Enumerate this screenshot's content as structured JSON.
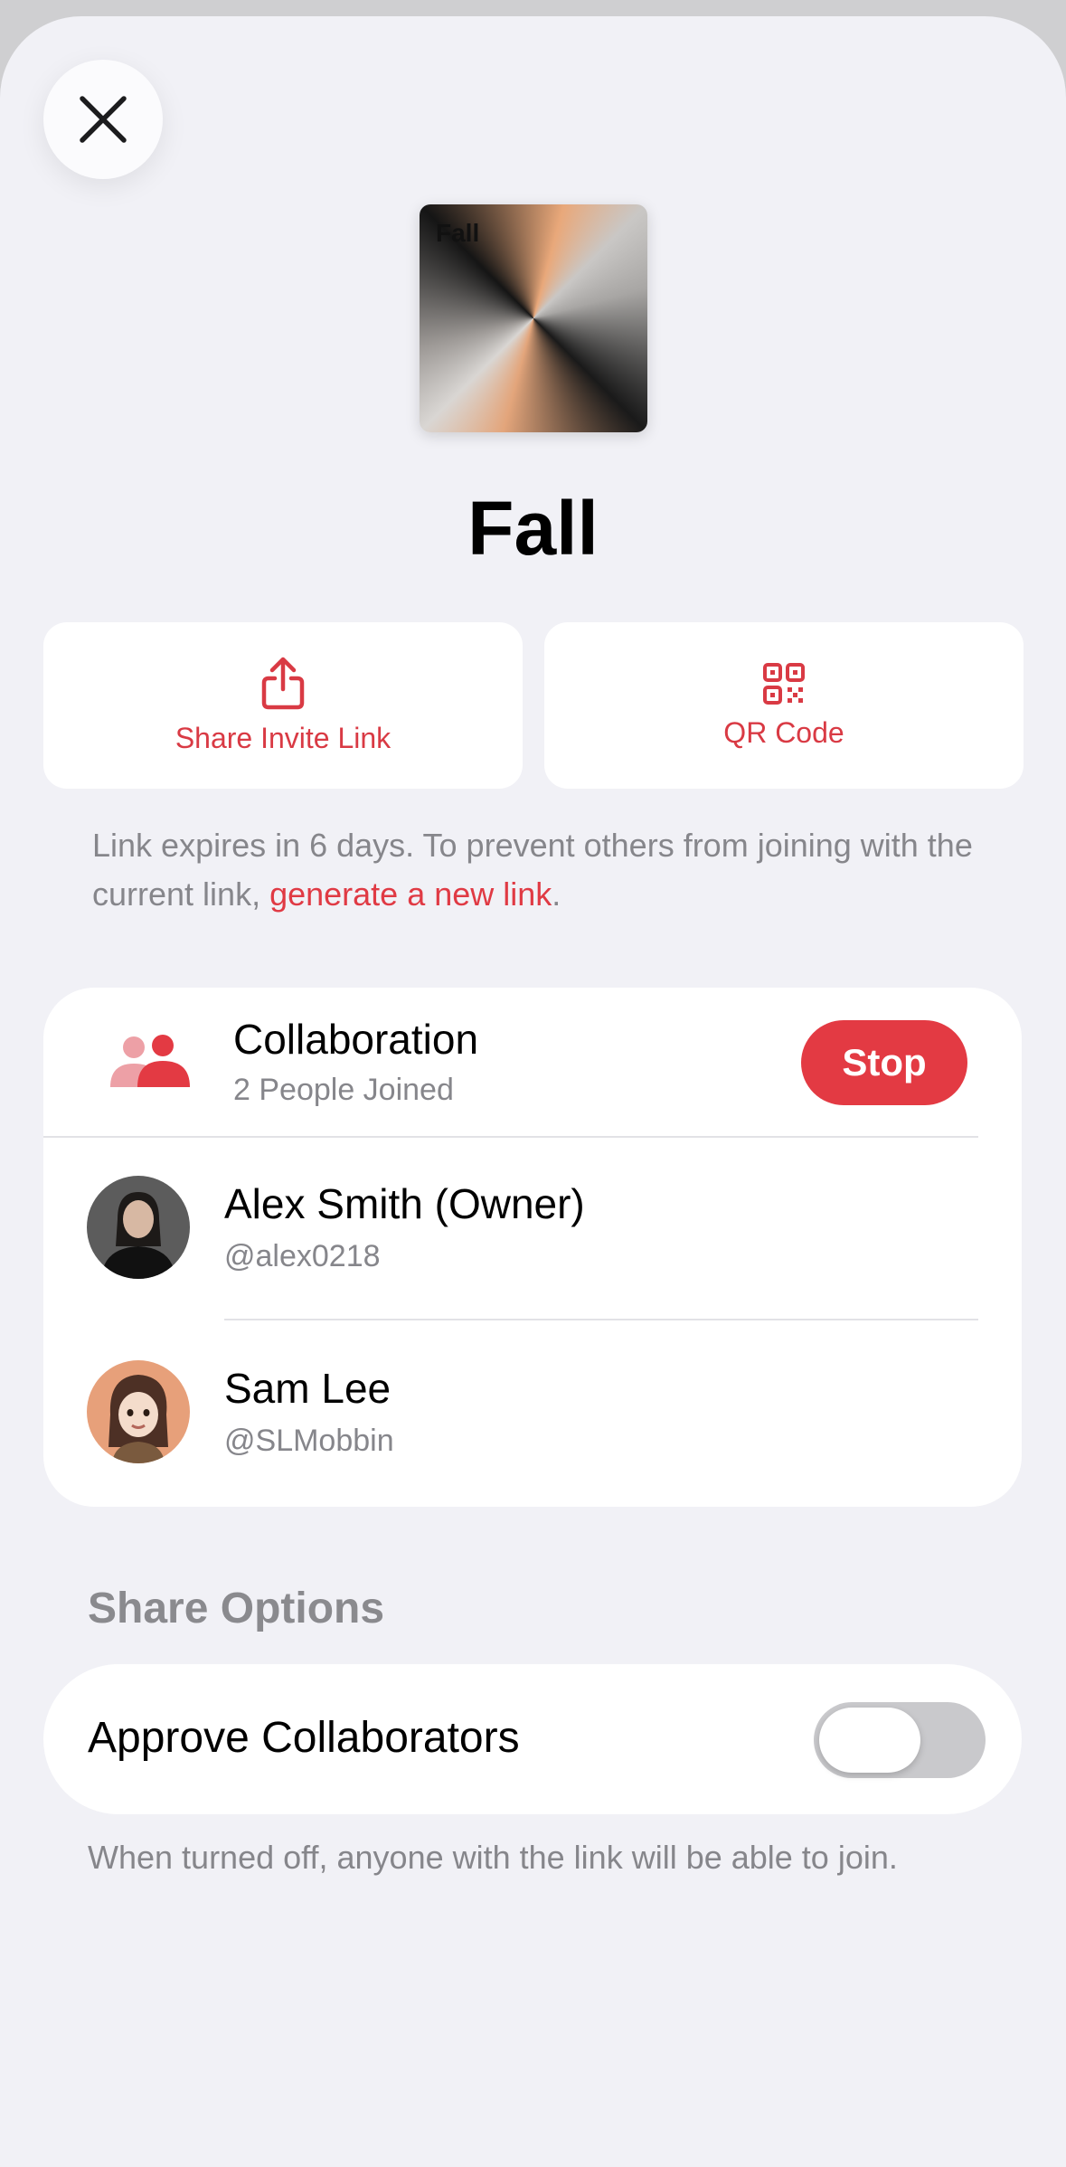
{
  "sheet": {
    "close_icon": "close-icon"
  },
  "artwork": {
    "label": "Fall"
  },
  "playlist": {
    "title": "Fall"
  },
  "actions": {
    "share_label": "Share Invite Link",
    "share_icon": "share-icon",
    "qr_label": "QR Code",
    "qr_icon": "qr-code-icon"
  },
  "link_note": {
    "text": "Link expires in 6 days. To prevent others from joining with the current link, ",
    "link_text": "generate a new link",
    "suffix": "."
  },
  "collaboration": {
    "title": "Collaboration",
    "subtitle": "2 People Joined",
    "stop_label": "Stop",
    "icon": "people-icon",
    "members": [
      {
        "name": "Alex Smith (Owner)",
        "handle": "@alex0218"
      },
      {
        "name": "Sam Lee",
        "handle": "@SLMobbin"
      }
    ]
  },
  "share_options": {
    "heading": "Share Options",
    "approve_label": "Approve Collaborators",
    "approve_on": false,
    "note": "When turned off, anyone with the link will be able to join."
  },
  "colors": {
    "accent": "#e33a43",
    "background": "#f1f1f6",
    "secondary_text": "#86868b"
  }
}
